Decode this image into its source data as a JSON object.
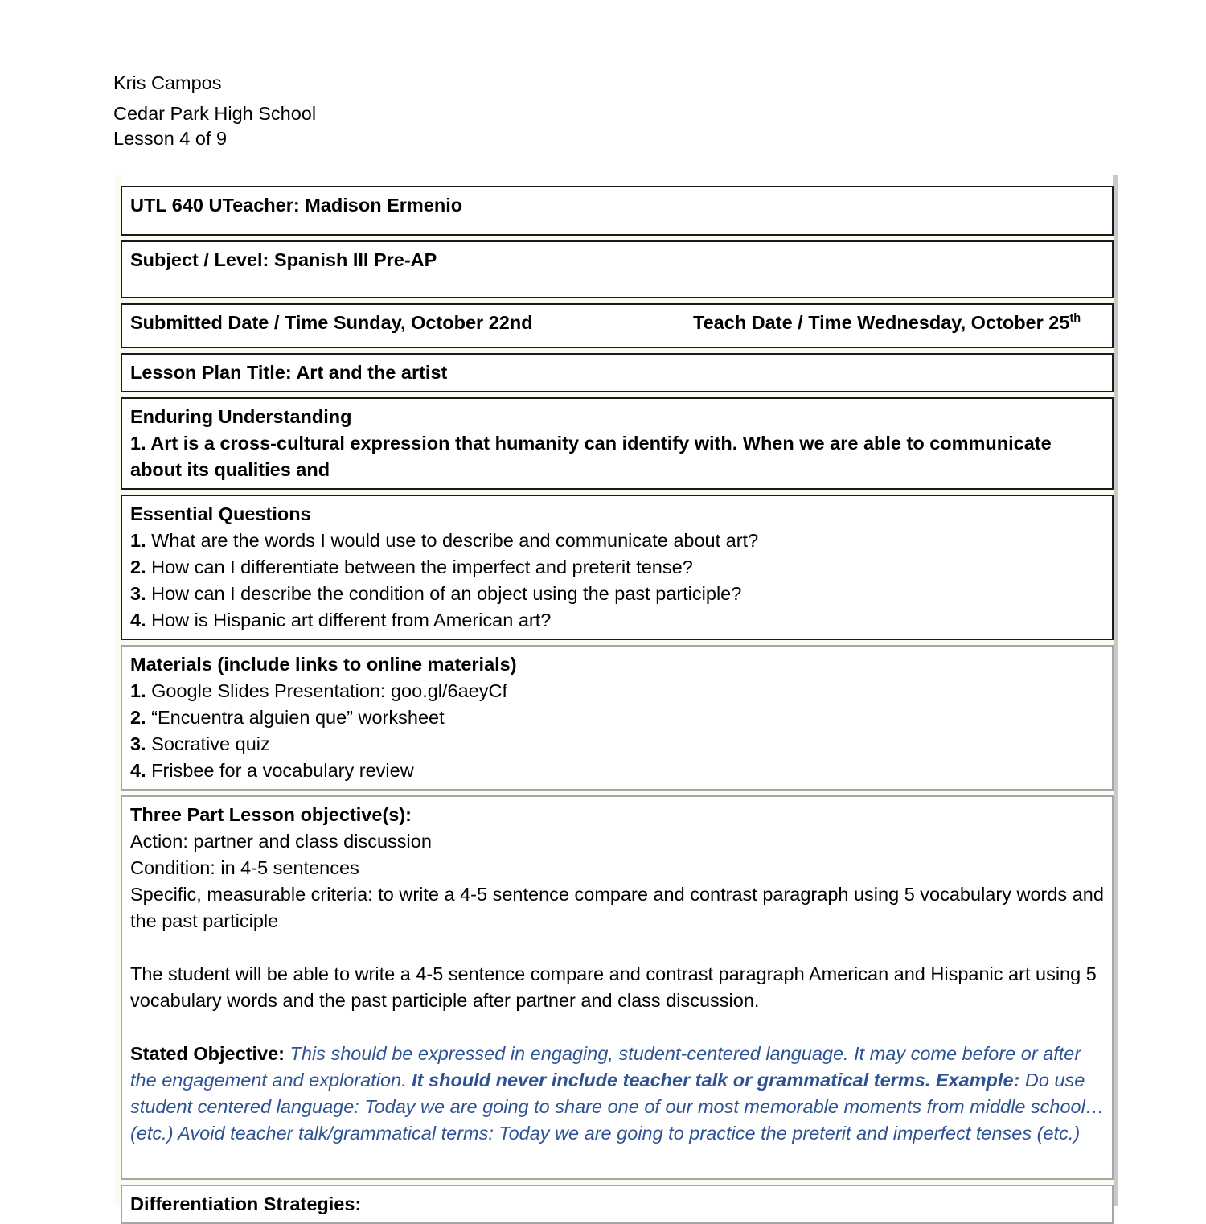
{
  "header": {
    "author": "Kris Campos",
    "school": "Cedar Park High School",
    "lesson_counter": "Lesson 4 of 9"
  },
  "table": {
    "course_teacher": "UTL 640 UTeacher: Madison Ermenio",
    "subject_level": "Subject / Level: Spanish III Pre-AP",
    "submitted_date": "Submitted Date / Time Sunday, October 22nd",
    "teach_date_prefix": "Teach Date / Time Wednesday, October 25",
    "teach_date_suffix": "th",
    "lesson_plan_title": "Lesson Plan Title: Art and the artist",
    "enduring_understanding": {
      "heading": "Enduring Understanding",
      "items": [
        {
          "num": "1.",
          "text": " Art is a cross-cultural expression that humanity can identify with.  When we are able to communicate about its qualities and"
        }
      ]
    },
    "essential_questions": {
      "heading": "Essential Questions",
      "items": [
        {
          "num": "1.",
          "text": " What are the words I would use to describe and communicate about art?"
        },
        {
          "num": "2.",
          "text": " How can I differentiate between the imperfect and preterit tense?"
        },
        {
          "num": "3.",
          "text": " How can I describe the condition of an object using the past participle?"
        },
        {
          "num": "4.",
          "text": " How is Hispanic art different from American art?"
        }
      ]
    },
    "materials": {
      "heading": "Materials (include links to online materials)",
      "items": [
        {
          "num": "1.",
          "text": " Google Slides Presentation: goo.gl/6aeyCf"
        },
        {
          "num": "2.",
          "text": " “Encuentra alguien que” worksheet"
        },
        {
          "num": "3.",
          "text": " Socrative quiz"
        },
        {
          "num": "4.",
          "text": " Frisbee for a vocabulary review"
        }
      ]
    },
    "three_part_objective": {
      "heading": "Three Part Lesson objective(s):",
      "action": "Action: partner and class discussion",
      "condition": "Condition: in 4-5 sentences",
      "criteria": "Specific, measurable criteria: to write a 4-5 sentence compare and contrast paragraph using 5 vocabulary words and the past participle",
      "swbat": "The student will be able to write a 4-5 sentence compare and contrast paragraph American and Hispanic art using 5 vocabulary words and the past participle after partner and class discussion.",
      "stated_objective_label": "Stated Objective:",
      "stated_objective_part1": " This should be expressed in engaging, student-centered language. It may come before or after the engagement and exploration. ",
      "stated_objective_bold": "It should never include teacher talk or grammatical terms. Example:",
      "stated_objective_part2": " Do use student centered language: Today we are going to share one of our most memorable moments from middle school…(etc.) Avoid teacher talk/grammatical terms: Today we are going to practice the preterit and imperfect tenses (etc.)"
    },
    "differentiation": {
      "heading": "Differentiation Strategies:"
    }
  },
  "colors": {
    "accent_blue": "#2e5395",
    "border_heavy": "#1a1a1a",
    "border_light": "#a6a6a6",
    "page_background": "#ffffff"
  }
}
